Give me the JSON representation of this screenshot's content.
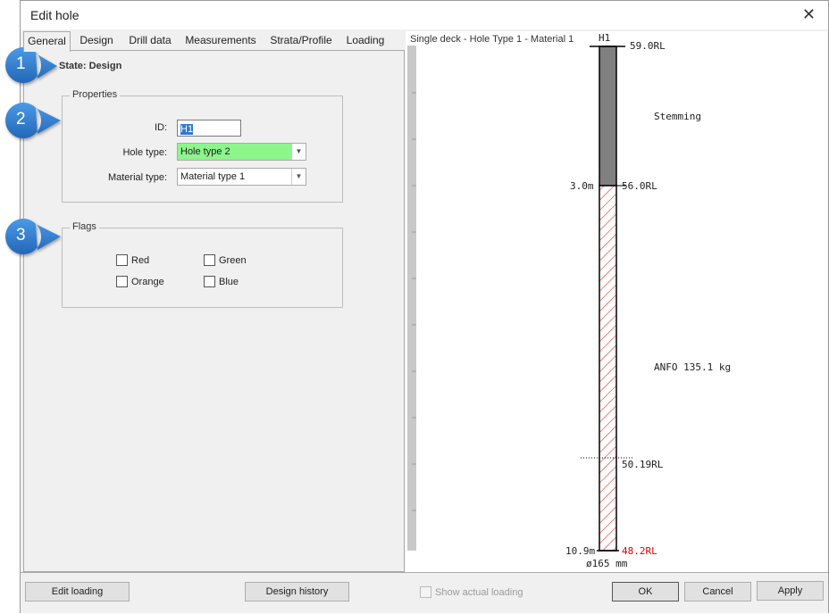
{
  "window": {
    "title": "Edit hole",
    "close_glyph": "✕"
  },
  "tabs": [
    {
      "label": "General",
      "active": true
    },
    {
      "label": "Design"
    },
    {
      "label": "Drill data"
    },
    {
      "label": "Measurements"
    },
    {
      "label": "Strata/Profile"
    },
    {
      "label": "Loading"
    }
  ],
  "state_label": "State: Design",
  "properties": {
    "legend": "Properties",
    "id_label": "ID:",
    "id_value": "H1",
    "hole_type_label": "Hole type:",
    "hole_type_value": "Hole type 2",
    "material_type_label": "Material type:",
    "material_type_value": "Material type 1"
  },
  "flags": {
    "legend": "Flags",
    "items": [
      {
        "label": "Red",
        "checked": false
      },
      {
        "label": "Green",
        "checked": false
      },
      {
        "label": "Orange",
        "checked": false
      },
      {
        "label": "Blue",
        "checked": false
      }
    ]
  },
  "callouts": [
    "1",
    "2",
    "3"
  ],
  "diagram": {
    "title": "Single deck - Hole Type 1 - Material 1",
    "hole_id": "H1",
    "top_rl": "59.0RL",
    "stemming_label": "Stemming",
    "stemming_depth": "3.0m",
    "stemming_rl": "56.0RL",
    "charge_label": "ANFO 135.1 kg",
    "dotted_rl": "50.19RL",
    "bottom_depth": "10.9m",
    "bottom_rl": "48.2RL",
    "diameter": "ø165 mm",
    "colors": {
      "stemming": "#808080",
      "charge_hatch": "#e03030",
      "bottom_rl": "#e00000"
    }
  },
  "buttons": {
    "edit_loading": "Edit loading",
    "design_history": "Design history",
    "show_actual_loading": "Show actual loading",
    "ok": "OK",
    "cancel": "Cancel",
    "apply": "Apply"
  }
}
